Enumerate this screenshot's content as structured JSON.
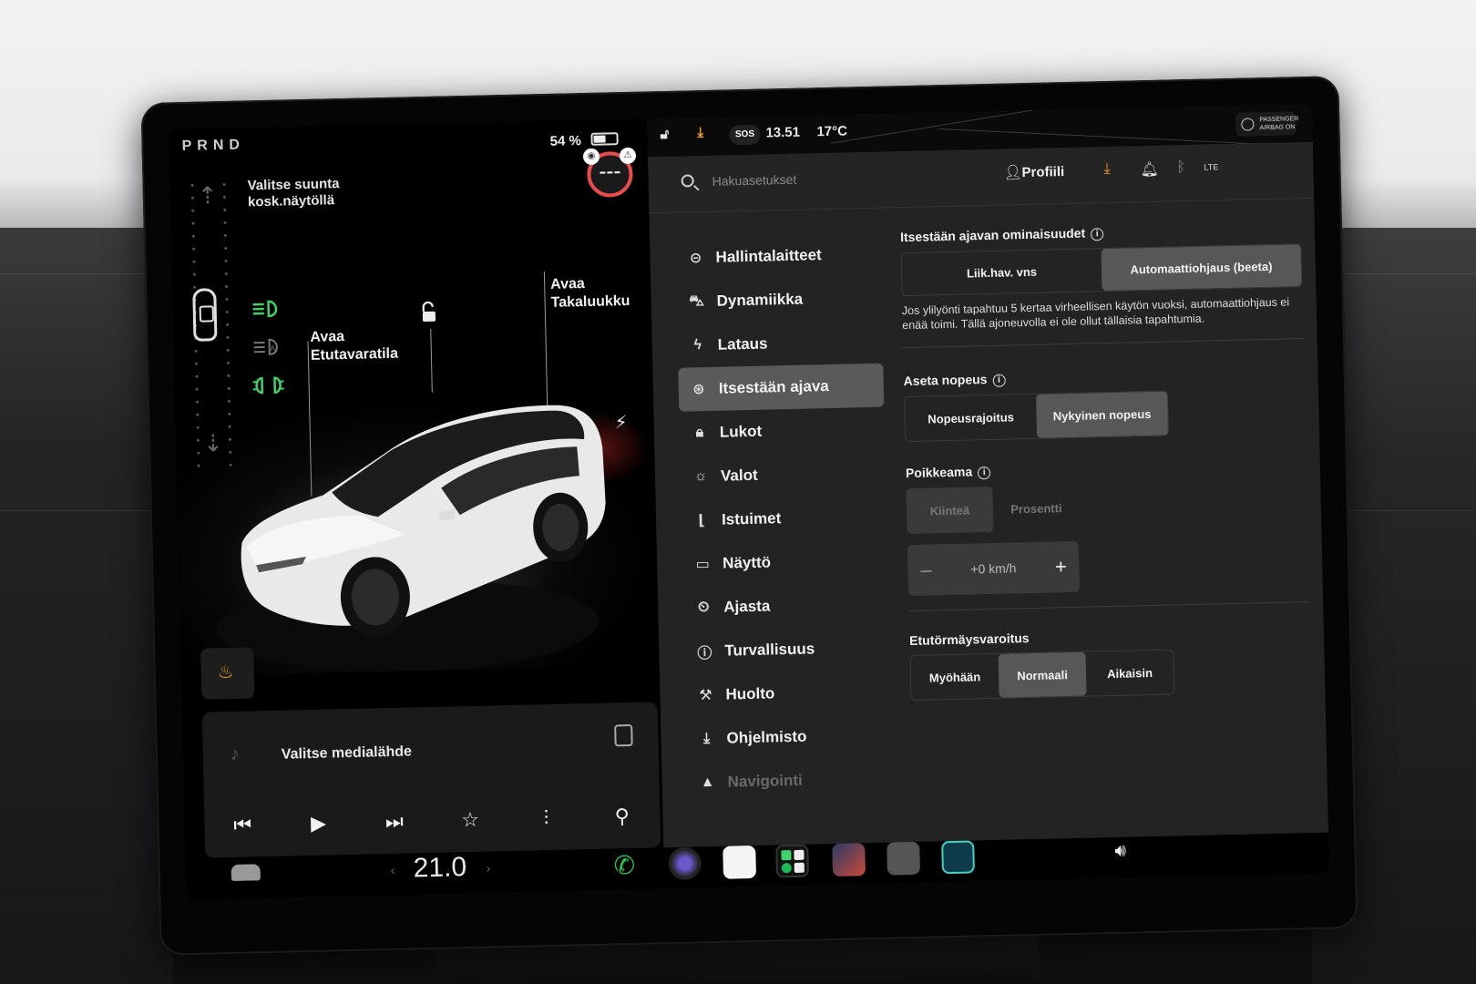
{
  "left_panel": {
    "gear": "PRND",
    "shift_hint": "Valitse suunta kosk.näytöllä",
    "battery_percent": "54 %",
    "battery_level": 0.54,
    "frunk_label": "Avaa Etutavaratila",
    "trunk_label": "Avaa Takaluukku",
    "media_title": "Valitse medialähde"
  },
  "topbar": {
    "sos": "SOS",
    "time": "13.51",
    "temperature": "17°C",
    "passenger_airbag": "PASSENGER AIRBAG ON"
  },
  "search": {
    "placeholder": "Hakuasetukset",
    "profile_label": "Profiili",
    "network": "LTE"
  },
  "menu": {
    "items": [
      {
        "label": "Hallintalaitteet",
        "icon": "toggle-icon"
      },
      {
        "label": "Dynamiikka",
        "icon": "car-icon"
      },
      {
        "label": "Lataus",
        "icon": "bolt-icon"
      },
      {
        "label": "Itsestään ajava",
        "icon": "steering-wheel-icon",
        "active": true
      },
      {
        "label": "Lukot",
        "icon": "lock-icon"
      },
      {
        "label": "Valot",
        "icon": "sun-icon"
      },
      {
        "label": "Istuimet",
        "icon": "seat-icon"
      },
      {
        "label": "Näyttö",
        "icon": "display-icon"
      },
      {
        "label": "Ajasta",
        "icon": "alarm-clock-icon"
      },
      {
        "label": "Turvallisuus",
        "icon": "alert-circle-icon"
      },
      {
        "label": "Huolto",
        "icon": "wrench-icon"
      },
      {
        "label": "Ohjelmisto",
        "icon": "download-icon"
      },
      {
        "label": "Navigointi",
        "icon": "navigation-icon"
      }
    ]
  },
  "autopilot": {
    "features_title": "Itsestään ajavan ominaisuudet",
    "features_options": [
      "Liik.hav. vns",
      "Automaattiohjaus (beeta)"
    ],
    "features_selected": "Automaattiohjaus (beeta)",
    "features_note": "Jos ylilyönti tapahtuu 5 kertaa virheellisen käytön vuoksi, automaattiohjaus ei enää toimi. Tällä ajoneuvolla ei ole ollut tällaisia tapahtumia.",
    "speed_title": "Aseta nopeus",
    "speed_options": [
      "Nopeusrajoitus",
      "Nykyinen nopeus"
    ],
    "speed_selected": "Nykyinen nopeus",
    "offset_title": "Poikkeama",
    "offset_options": [
      "Kiinteä",
      "Prosentti"
    ],
    "offset_value": "+0 km/h",
    "stepper_minus": "–",
    "stepper_plus": "+",
    "fcw_title": "Etutörmäysvaroitus",
    "fcw_options": [
      "Myöhään",
      "Normaali",
      "Aikaisin"
    ],
    "fcw_selected": "Normaali"
  },
  "dock": {
    "cabin_temp": "21.0"
  },
  "colors": {
    "accent_orange": "#f0a020",
    "light_green": "#3fd26b",
    "airbag_red": "#e84c4c",
    "phone_green": "#27c44f"
  }
}
